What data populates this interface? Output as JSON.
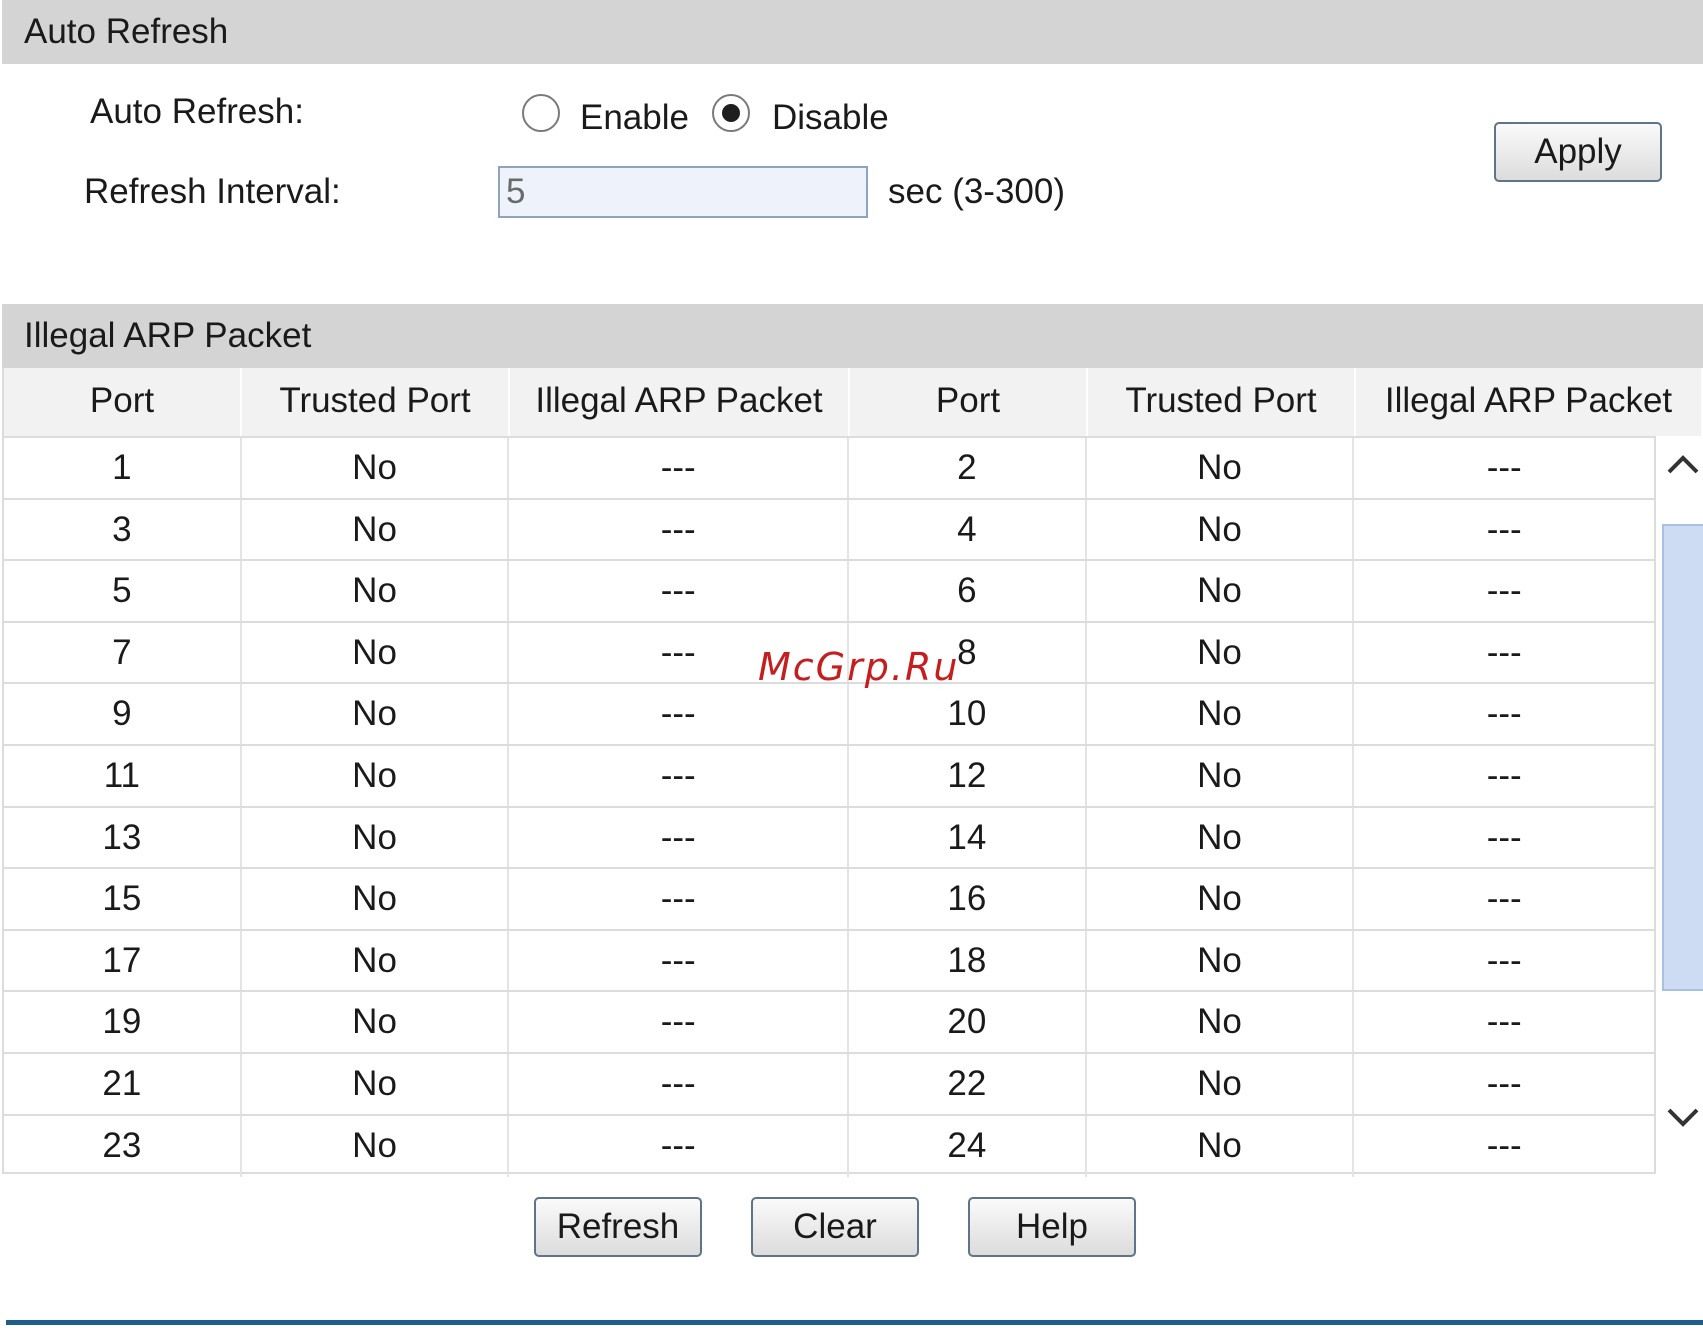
{
  "auto_refresh_section": {
    "title": "Auto Refresh",
    "auto_refresh_label": "Auto Refresh:",
    "enable_label": "Enable",
    "disable_label": "Disable",
    "selected": "Disable",
    "interval_label": "Refresh Interval:",
    "interval_value": "5",
    "interval_hint": "sec (3-300)",
    "apply_label": "Apply"
  },
  "arp_section": {
    "title": "Illegal ARP Packet",
    "headers": [
      "Port",
      "Trusted Port",
      "Illegal ARP Packet",
      "Port",
      "Trusted Port",
      "Illegal ARP Packet"
    ],
    "rows": [
      [
        "1",
        "No",
        "---",
        "2",
        "No",
        "---"
      ],
      [
        "3",
        "No",
        "---",
        "4",
        "No",
        "---"
      ],
      [
        "5",
        "No",
        "---",
        "6",
        "No",
        "---"
      ],
      [
        "7",
        "No",
        "---",
        "8",
        "No",
        "---"
      ],
      [
        "9",
        "No",
        "---",
        "10",
        "No",
        "---"
      ],
      [
        "11",
        "No",
        "---",
        "12",
        "No",
        "---"
      ],
      [
        "13",
        "No",
        "---",
        "14",
        "No",
        "---"
      ],
      [
        "15",
        "No",
        "---",
        "16",
        "No",
        "---"
      ],
      [
        "17",
        "No",
        "---",
        "18",
        "No",
        "---"
      ],
      [
        "19",
        "No",
        "---",
        "20",
        "No",
        "---"
      ],
      [
        "21",
        "No",
        "---",
        "22",
        "No",
        "---"
      ],
      [
        "23",
        "No",
        "---",
        "24",
        "No",
        "---"
      ]
    ]
  },
  "actions": {
    "refresh_label": "Refresh",
    "clear_label": "Clear",
    "help_label": "Help"
  },
  "watermark": "McGrp.Ru",
  "icons": {
    "scroll_up": "chevron-up-icon",
    "scroll_down": "chevron-down-icon"
  },
  "colors": {
    "section_header_bg": "#d4d4d4",
    "input_bg": "#eef2fa",
    "scroll_thumb": "#cddcf3",
    "footer_line": "#1f5d8f",
    "watermark": "#c41e1e"
  }
}
